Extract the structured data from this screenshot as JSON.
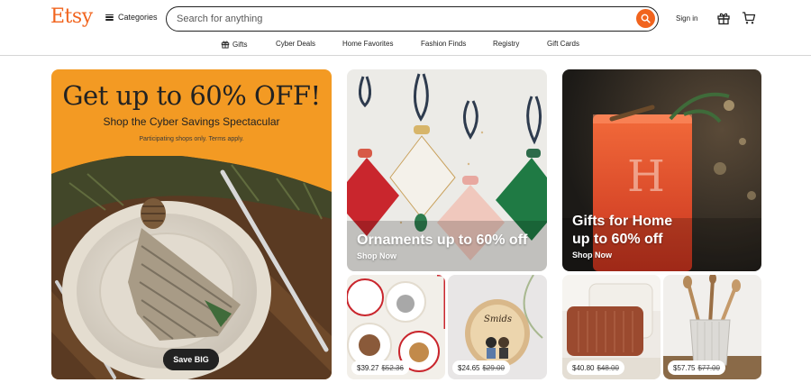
{
  "header": {
    "logo": "Etsy",
    "categories_label": "Categories",
    "search_placeholder": "Search for anything",
    "signin_label": "Sign in"
  },
  "nav": {
    "items": [
      {
        "label": "Gifts",
        "icon": "gift-icon"
      },
      {
        "label": "Cyber Deals"
      },
      {
        "label": "Home Favorites"
      },
      {
        "label": "Fashion Finds"
      },
      {
        "label": "Registry"
      },
      {
        "label": "Gift Cards"
      }
    ]
  },
  "promo": {
    "headline": "Get up to 60% OFF!",
    "subheading": "Shop the Cyber Savings Spectacular",
    "terms": "Participating shops only. Terms apply.",
    "button_label": "Save BIG"
  },
  "features": [
    {
      "title_line1": "Ornaments up to 60% off",
      "title_line2": "",
      "cta": "Shop Now"
    },
    {
      "title_line1": "Gifts for Home",
      "title_line2": "up to 60% off",
      "cta": "Shop Now"
    }
  ],
  "products": [
    {
      "price": "$39.27",
      "original_price": "$52.36"
    },
    {
      "price": "$24.65",
      "original_price": "$29.00"
    },
    {
      "price": "$40.80",
      "original_price": "$48.00"
    },
    {
      "price": "$57.75",
      "original_price": "$77.00"
    }
  ],
  "colors": {
    "brand": "#f1641e",
    "promo_background": "#f39a23",
    "text": "#222222"
  }
}
